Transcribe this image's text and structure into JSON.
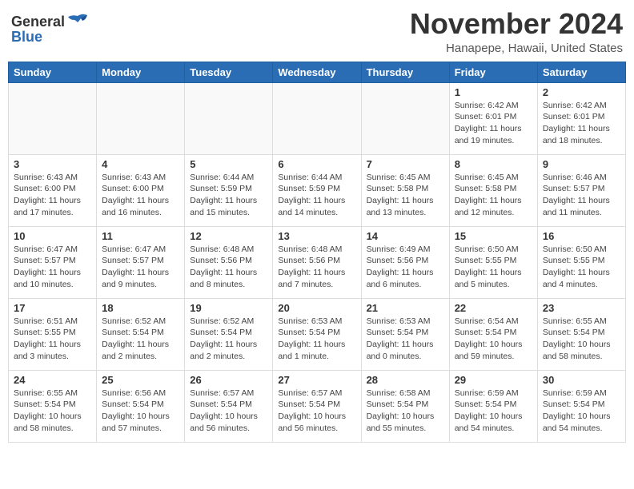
{
  "header": {
    "logo_general": "General",
    "logo_blue": "Blue",
    "month_title": "November 2024",
    "location": "Hanapepe, Hawaii, United States"
  },
  "days_of_week": [
    "Sunday",
    "Monday",
    "Tuesday",
    "Wednesday",
    "Thursday",
    "Friday",
    "Saturday"
  ],
  "weeks": [
    [
      {
        "day": "",
        "info": ""
      },
      {
        "day": "",
        "info": ""
      },
      {
        "day": "",
        "info": ""
      },
      {
        "day": "",
        "info": ""
      },
      {
        "day": "",
        "info": ""
      },
      {
        "day": "1",
        "info": "Sunrise: 6:42 AM\nSunset: 6:01 PM\nDaylight: 11 hours\nand 19 minutes."
      },
      {
        "day": "2",
        "info": "Sunrise: 6:42 AM\nSunset: 6:01 PM\nDaylight: 11 hours\nand 18 minutes."
      }
    ],
    [
      {
        "day": "3",
        "info": "Sunrise: 6:43 AM\nSunset: 6:00 PM\nDaylight: 11 hours\nand 17 minutes."
      },
      {
        "day": "4",
        "info": "Sunrise: 6:43 AM\nSunset: 6:00 PM\nDaylight: 11 hours\nand 16 minutes."
      },
      {
        "day": "5",
        "info": "Sunrise: 6:44 AM\nSunset: 5:59 PM\nDaylight: 11 hours\nand 15 minutes."
      },
      {
        "day": "6",
        "info": "Sunrise: 6:44 AM\nSunset: 5:59 PM\nDaylight: 11 hours\nand 14 minutes."
      },
      {
        "day": "7",
        "info": "Sunrise: 6:45 AM\nSunset: 5:58 PM\nDaylight: 11 hours\nand 13 minutes."
      },
      {
        "day": "8",
        "info": "Sunrise: 6:45 AM\nSunset: 5:58 PM\nDaylight: 11 hours\nand 12 minutes."
      },
      {
        "day": "9",
        "info": "Sunrise: 6:46 AM\nSunset: 5:57 PM\nDaylight: 11 hours\nand 11 minutes."
      }
    ],
    [
      {
        "day": "10",
        "info": "Sunrise: 6:47 AM\nSunset: 5:57 PM\nDaylight: 11 hours\nand 10 minutes."
      },
      {
        "day": "11",
        "info": "Sunrise: 6:47 AM\nSunset: 5:57 PM\nDaylight: 11 hours\nand 9 minutes."
      },
      {
        "day": "12",
        "info": "Sunrise: 6:48 AM\nSunset: 5:56 PM\nDaylight: 11 hours\nand 8 minutes."
      },
      {
        "day": "13",
        "info": "Sunrise: 6:48 AM\nSunset: 5:56 PM\nDaylight: 11 hours\nand 7 minutes."
      },
      {
        "day": "14",
        "info": "Sunrise: 6:49 AM\nSunset: 5:56 PM\nDaylight: 11 hours\nand 6 minutes."
      },
      {
        "day": "15",
        "info": "Sunrise: 6:50 AM\nSunset: 5:55 PM\nDaylight: 11 hours\nand 5 minutes."
      },
      {
        "day": "16",
        "info": "Sunrise: 6:50 AM\nSunset: 5:55 PM\nDaylight: 11 hours\nand 4 minutes."
      }
    ],
    [
      {
        "day": "17",
        "info": "Sunrise: 6:51 AM\nSunset: 5:55 PM\nDaylight: 11 hours\nand 3 minutes."
      },
      {
        "day": "18",
        "info": "Sunrise: 6:52 AM\nSunset: 5:54 PM\nDaylight: 11 hours\nand 2 minutes."
      },
      {
        "day": "19",
        "info": "Sunrise: 6:52 AM\nSunset: 5:54 PM\nDaylight: 11 hours\nand 2 minutes."
      },
      {
        "day": "20",
        "info": "Sunrise: 6:53 AM\nSunset: 5:54 PM\nDaylight: 11 hours\nand 1 minute."
      },
      {
        "day": "21",
        "info": "Sunrise: 6:53 AM\nSunset: 5:54 PM\nDaylight: 11 hours\nand 0 minutes."
      },
      {
        "day": "22",
        "info": "Sunrise: 6:54 AM\nSunset: 5:54 PM\nDaylight: 10 hours\nand 59 minutes."
      },
      {
        "day": "23",
        "info": "Sunrise: 6:55 AM\nSunset: 5:54 PM\nDaylight: 10 hours\nand 58 minutes."
      }
    ],
    [
      {
        "day": "24",
        "info": "Sunrise: 6:55 AM\nSunset: 5:54 PM\nDaylight: 10 hours\nand 58 minutes."
      },
      {
        "day": "25",
        "info": "Sunrise: 6:56 AM\nSunset: 5:54 PM\nDaylight: 10 hours\nand 57 minutes."
      },
      {
        "day": "26",
        "info": "Sunrise: 6:57 AM\nSunset: 5:54 PM\nDaylight: 10 hours\nand 56 minutes."
      },
      {
        "day": "27",
        "info": "Sunrise: 6:57 AM\nSunset: 5:54 PM\nDaylight: 10 hours\nand 56 minutes."
      },
      {
        "day": "28",
        "info": "Sunrise: 6:58 AM\nSunset: 5:54 PM\nDaylight: 10 hours\nand 55 minutes."
      },
      {
        "day": "29",
        "info": "Sunrise: 6:59 AM\nSunset: 5:54 PM\nDaylight: 10 hours\nand 54 minutes."
      },
      {
        "day": "30",
        "info": "Sunrise: 6:59 AM\nSunset: 5:54 PM\nDaylight: 10 hours\nand 54 minutes."
      }
    ]
  ]
}
